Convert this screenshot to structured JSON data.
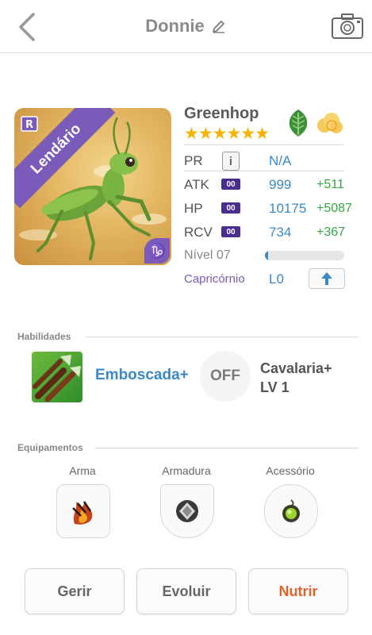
{
  "header": {
    "title": "Donnie",
    "back_icon": "chevron-left-icon",
    "edit_icon": "pencil-icon",
    "camera_icon": "camera-icon"
  },
  "monster": {
    "name": "Greenhop",
    "rarity_label": "Lendário",
    "stars": "★★★★★★",
    "star_count": 6,
    "element_icon": "leaf-icon",
    "class_icon": "cloud-icon",
    "zodiac_icon": "capricorn-icon",
    "stats": {
      "pr": {
        "label": "PR",
        "value": "N/A"
      },
      "atk": {
        "label": "ATK",
        "badge": "00",
        "value": "999",
        "bonus": "+511"
      },
      "hp": {
        "label": "HP",
        "badge": "00",
        "value": "10175",
        "bonus": "+5087"
      },
      "rcv": {
        "label": "RCV",
        "badge": "00",
        "value": "734",
        "bonus": "+367"
      }
    },
    "level_label": "Nível 07",
    "level_progress": 0.04,
    "zodiac": {
      "label": "Capricórnio",
      "value": "L0"
    }
  },
  "skills": {
    "section_title": "Habilidades",
    "skill1": {
      "name": "Emboscada+"
    },
    "off_label": "OFF",
    "skill2": {
      "name": "Cavalaria+",
      "level": "LV 1"
    }
  },
  "equipment": {
    "section_title": "Equipamentos",
    "slots": [
      {
        "label": "Arma",
        "icon": "flame-claw-icon"
      },
      {
        "label": "Armadura",
        "icon": "diamond-shield-icon"
      },
      {
        "label": "Acessório",
        "icon": "green-orb-icon"
      }
    ]
  },
  "actions": {
    "manage": "Gerir",
    "evolve": "Evoluir",
    "feed": "Nutrir"
  },
  "colors": {
    "accent_blue": "#3b88c7",
    "bonus_green": "#35a845",
    "rarity_purple": "#7b5bb9",
    "stars": "#f5b400",
    "feed_orange": "#e0642a"
  }
}
